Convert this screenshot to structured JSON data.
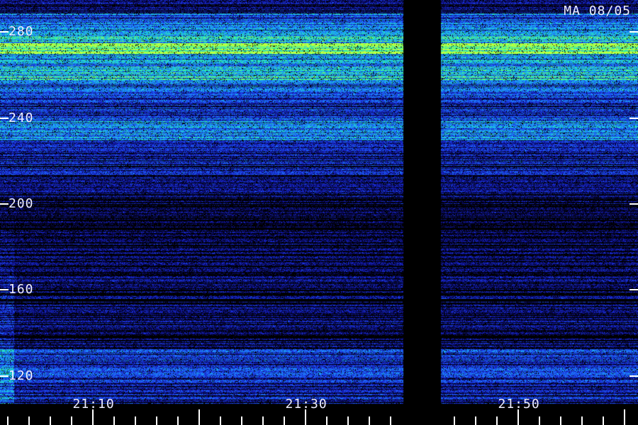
{
  "chart_data": {
    "type": "heatmap",
    "title": "MA 08/05",
    "y_ticks": [
      {
        "value": 280,
        "label": "280"
      },
      {
        "value": 240,
        "label": "240"
      },
      {
        "value": 200,
        "label": "200"
      },
      {
        "value": 160,
        "label": "160"
      },
      {
        "value": 120,
        "label": "120"
      }
    ],
    "x_ticks": [
      {
        "label": "21:10",
        "minutes": 10
      },
      {
        "label": "21:30",
        "minutes": 30
      },
      {
        "label": "21:50",
        "minutes": 50
      }
    ],
    "ylim": [
      107,
      295
    ],
    "xlim_minutes": [
      1.3,
      61.3
    ],
    "data_gap_minutes": [
      39.2,
      42.7
    ],
    "bright_bands": [
      {
        "from": 289,
        "to": 279,
        "level": 0.55
      },
      {
        "from": 279,
        "to": 275,
        "level": 0.78
      },
      {
        "from": 275,
        "to": 270,
        "level": 0.95
      },
      {
        "from": 270,
        "to": 264,
        "level": 0.6
      },
      {
        "from": 264,
        "to": 258,
        "level": 0.72
      },
      {
        "from": 258,
        "to": 250,
        "level": 0.5
      },
      {
        "from": 250,
        "to": 240,
        "level": 0.38
      },
      {
        "from": 240,
        "to": 230,
        "level": 0.55
      },
      {
        "from": 230,
        "to": 212,
        "level": 0.3
      },
      {
        "from": 212,
        "to": 200,
        "level": 0.18
      },
      {
        "from": 200,
        "to": 183,
        "level": 0.1
      },
      {
        "from": 183,
        "to": 133,
        "level": 0.18
      },
      {
        "from": 133,
        "to": 120,
        "level": 0.4
      },
      {
        "from": 120,
        "to": 107,
        "level": 0.33
      }
    ],
    "colormap": [
      "#000000",
      "#0a0a6e",
      "#1a2ad8",
      "#1e6bff",
      "#18c8e8",
      "#3cff8a",
      "#c8ff3c"
    ]
  }
}
